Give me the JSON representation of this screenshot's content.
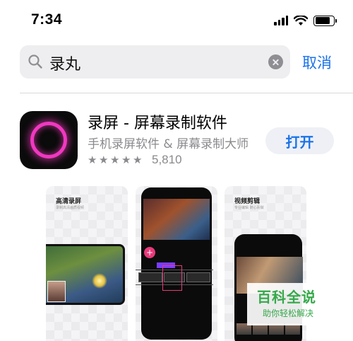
{
  "status_bar": {
    "time": "7:34",
    "icons": [
      "signal-icon",
      "wifi-icon",
      "battery-icon"
    ]
  },
  "search": {
    "query": "录丸",
    "cancel_label": "取消",
    "icons": [
      "search-icon",
      "clear-icon"
    ]
  },
  "app": {
    "title": "录屏 - 屏幕录制软件",
    "subtitle": "手机录屏软件 & 屏幕录制大师",
    "rating_stars": 5,
    "rating_count": "5,810",
    "open_label": "打开",
    "icon": "ring-icon",
    "accent_color": "#f038c0"
  },
  "screenshots": [
    {
      "title": "高清录屏",
      "subtitle": "录制高清画质视频"
    },
    {
      "title": "",
      "subtitle": ""
    },
    {
      "title": "视频剪辑",
      "subtitle": "专业编辑 随心而做"
    }
  ],
  "watermark": {
    "title": "百科全说",
    "subtitle": "助你轻松解决",
    "color": "#35a94a"
  },
  "colors": {
    "link_blue": "#1a73e8",
    "secondary_text": "#8a8a8e"
  }
}
